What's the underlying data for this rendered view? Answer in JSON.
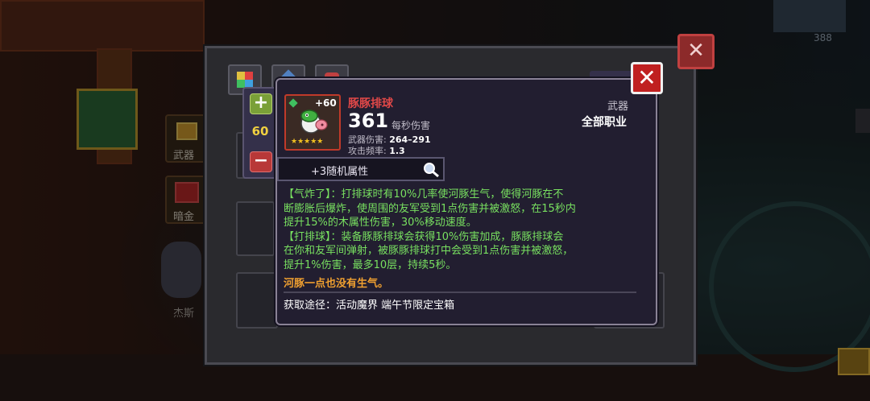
{
  "background": {
    "side_tabs": [
      {
        "label": "武器"
      },
      {
        "label": "暗金"
      }
    ],
    "character_name": "杰斯",
    "currency_value": "388"
  },
  "level_control": {
    "value": "60",
    "plus_icon": "plus-icon",
    "minus_icon": "minus-icon"
  },
  "item": {
    "name": "豚豚排球",
    "plus_level": "+60",
    "stars": "★★★★★",
    "dps_value": "361",
    "dps_label": "每秒伤害",
    "damage_label": "武器伤害:",
    "damage_value": "264–291",
    "rate_label": "攻击频率:",
    "rate_value": "1.3",
    "category": "武器",
    "class_restriction": "全部职业",
    "random_attr_label": "+3随机属性",
    "description": [
      "【气炸了】：打排球时有10%几率使河豚生气，使得河豚在不",
      "断膨胀后爆炸，使周围的友军受到1点伤害并被激怒，在15秒内",
      "提升15%的木属性伤害，30%移动速度。",
      "【打排球】：装备豚豚排球会获得10%伤害加成，豚豚排球会",
      "在你和友军间弹射，被豚豚排球打中会受到1点伤害并被激怒，",
      "提升1%伤害，最多10层，持续5秒。"
    ],
    "flavor_text": "河豚一点也没有生气。",
    "source_text": "获取途径：活动魔界 端午节限定宝箱"
  },
  "colors": {
    "name_red": "#e04848",
    "description_green": "#78e060",
    "flavor_orange": "#f0a030",
    "level_yellow": "#f0d040"
  }
}
